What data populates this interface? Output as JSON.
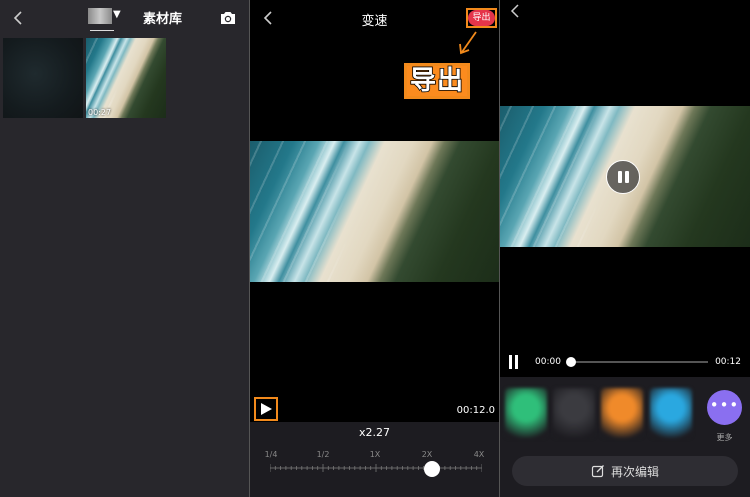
{
  "library": {
    "title": "素材库",
    "video_duration": "00:27"
  },
  "speed_editor": {
    "title": "变速",
    "export_button": "导出",
    "callout_label": "导出",
    "time": "00:12.0",
    "speed_value": "x2.27",
    "tick_labels": [
      "1/4",
      "1/2",
      "1X",
      "2X",
      "4X"
    ],
    "speed_level": 2.27
  },
  "preview": {
    "current_time": "00:00",
    "total_time": "00:12",
    "progress": 0,
    "more_label": "更多",
    "reedit_label": "再次编辑",
    "filter_colors": [
      "#2fbf7a",
      "#3b3b40",
      "#f08a2a",
      "#2aa8e0"
    ]
  },
  "colors": {
    "accent_orange": "#f28a1c",
    "export_red": "#e5344a",
    "more_purple": "#8a6ff0"
  }
}
